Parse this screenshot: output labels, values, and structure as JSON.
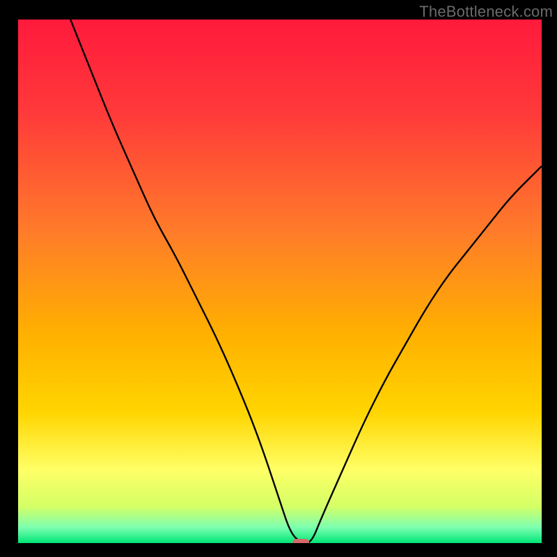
{
  "watermark": "TheBottleneck.com",
  "chart_data": {
    "type": "line",
    "title": "",
    "xlabel": "",
    "ylabel": "",
    "xlim": [
      0,
      100
    ],
    "ylim": [
      0,
      100
    ],
    "grid": false,
    "legend": false,
    "background_gradient": {
      "top": "#ff1a3c",
      "mid_upper": "#ff7a2a",
      "mid": "#ffd500",
      "mid_lower": "#ffff66",
      "bottom": "#00e676"
    },
    "curve": {
      "description": "V-shaped bottleneck curve; zero near x≈54, rising steeply to both sides",
      "color": "#000000",
      "minimum_marker": {
        "x": 54,
        "y": 0,
        "color": "#d46a6a"
      },
      "x": [
        10,
        14,
        18,
        22,
        26,
        30,
        34,
        38,
        42,
        46,
        50,
        52,
        54,
        56,
        58,
        62,
        66,
        70,
        74,
        78,
        82,
        86,
        90,
        94,
        98,
        100
      ],
      "y": [
        100,
        90,
        80,
        71,
        62,
        55,
        47,
        39,
        30,
        20,
        8,
        2,
        0,
        0,
        5,
        14,
        23,
        31,
        38,
        45,
        51,
        56,
        61,
        66,
        70,
        72
      ]
    }
  }
}
